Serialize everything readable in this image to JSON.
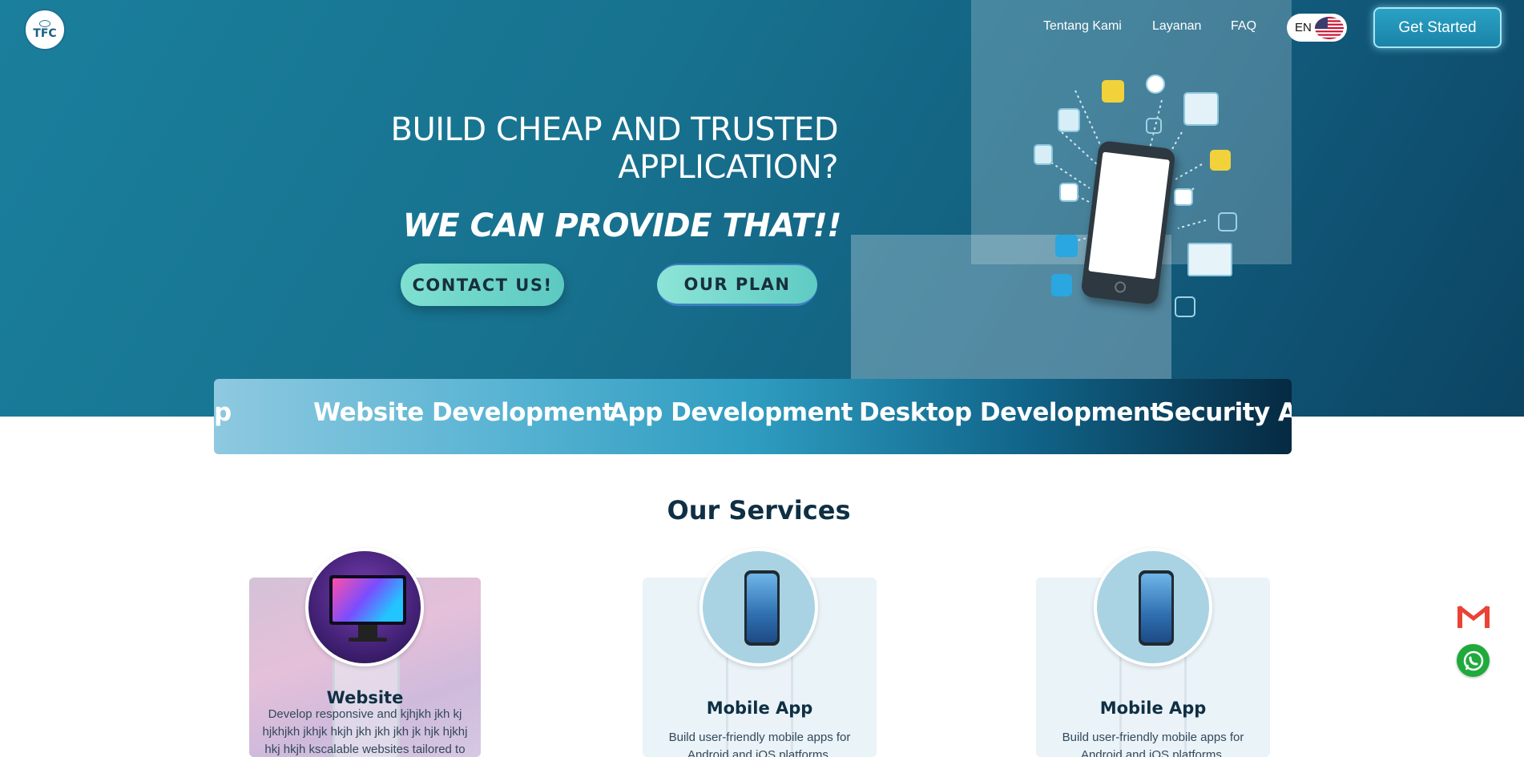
{
  "nav": {
    "logo_text": "TFC",
    "links": [
      "Tentang Kami",
      "Layanan",
      "FAQ"
    ],
    "language": "EN",
    "cta": "Get Started"
  },
  "hero": {
    "heading_line1": "BUILD CHEAP AND TRUSTED",
    "heading_line2": "APPLICATION?",
    "tagline": "WE CAN PROVIDE THAT!!",
    "contact_button": "CONTACT US!",
    "plan_button": "OUR PLAN"
  },
  "marquee": {
    "items": [
      "p",
      "Website Development",
      "App Development",
      "Desktop Development",
      "Security Ap"
    ]
  },
  "services": {
    "title": "Our Services",
    "cards": [
      {
        "title": "Website",
        "desc": "Develop responsive and kjhjkh jkh kj hjkhjkh jkhjk hkjh jkh jkh jkh jk hjk hjkhj hkj hkjh kscalable websites tailored to",
        "circle_image": "website-monitor-image"
      },
      {
        "title": "Mobile App",
        "desc": "Build user-friendly mobile apps for Android and iOS platforms.",
        "circle_image": "mobile-phone-image"
      },
      {
        "title": "Mobile App",
        "desc": "Build user-friendly mobile apps for Android and iOS platforms.",
        "circle_image": "mobile-phone-image"
      }
    ]
  },
  "floating": {
    "icons": [
      "gmail-icon",
      "whatsapp-icon"
    ]
  },
  "colors": {
    "hero_bg": "#17728f",
    "accent_button": "#5cc9c1",
    "heading_dark": "#0f2f44"
  }
}
